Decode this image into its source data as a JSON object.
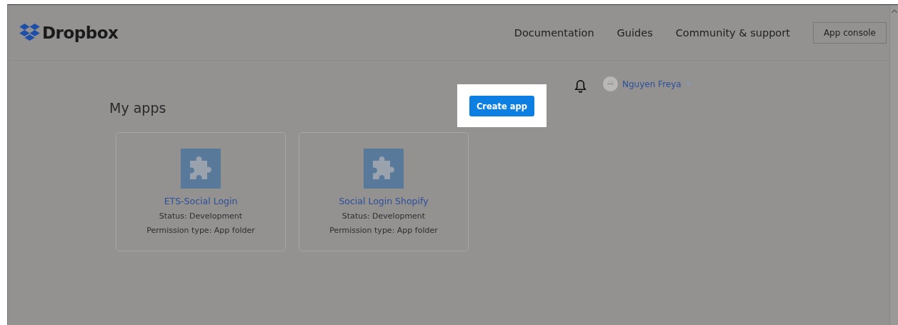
{
  "brand": {
    "name": "Dropbox"
  },
  "nav": [
    "Documentation",
    "Guides",
    "Community & support"
  ],
  "app_console_button": "App console",
  "user": {
    "name": "Nguyen Freya"
  },
  "page_title": "My apps",
  "create_button": "Create app",
  "apps": [
    {
      "name": "ETS-Social Login",
      "status": "Status: Development",
      "permission": "Permission type: App folder"
    },
    {
      "name": "Social Login Shopify",
      "status": "Status: Development",
      "permission": "Permission type: App folder"
    }
  ]
}
